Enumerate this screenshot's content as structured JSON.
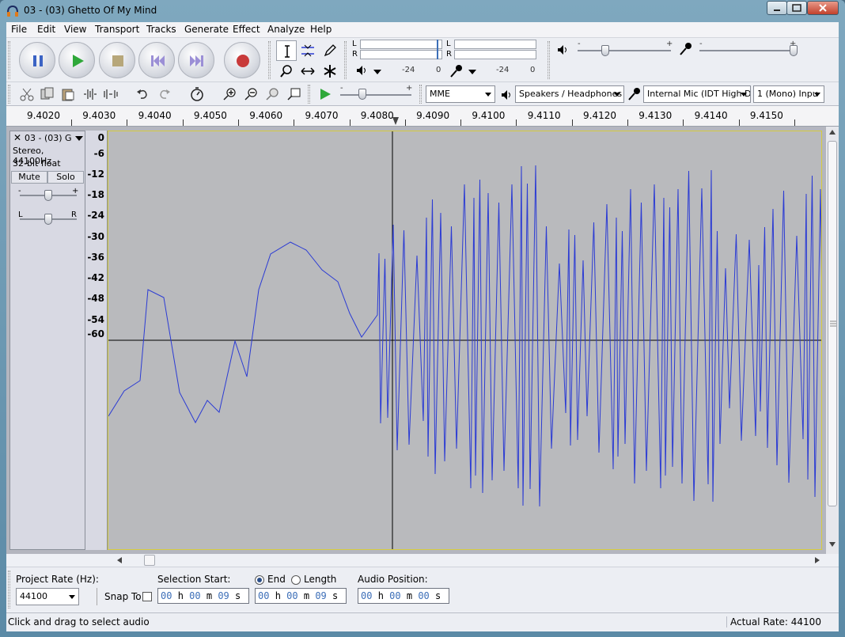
{
  "window": {
    "title": "03 - (03) Ghetto Of My Mind"
  },
  "menu": [
    "File",
    "Edit",
    "View",
    "Transport",
    "Tracks",
    "Generate",
    "Effect",
    "Analyze",
    "Help"
  ],
  "meter": {
    "play_l": "L",
    "play_r": "R",
    "rec_l": "L",
    "rec_r": "R",
    "ticks_play": [
      "-24",
      "0"
    ],
    "ticks_rec": [
      "-24",
      "0"
    ]
  },
  "device": {
    "host": "MME",
    "output": "Speakers / Headphones",
    "input": "Internal Mic (IDT High D",
    "channels": "1 (Mono) Inpu"
  },
  "ruler": {
    "ticks": [
      "9.4020",
      "9.4030",
      "9.4040",
      "9.4050",
      "9.4060",
      "9.4070",
      "9.4080",
      "9.4090",
      "9.4100",
      "9.4110",
      "9.4120",
      "9.4130",
      "9.4140",
      "9.4150"
    ]
  },
  "track": {
    "name": "03 - (03) G",
    "format": "Stereo, 44100Hz",
    "depth": "32-bit float",
    "mute": "Mute",
    "solo": "Solo",
    "gain_minus": "-",
    "gain_plus": "+",
    "pan_left": "L",
    "pan_right": "R",
    "gain_level": 0.5,
    "pan_level": 0.5
  },
  "vruler": [
    "0",
    "-6",
    "-12",
    "-18",
    "-24",
    "-30",
    "-36",
    "-42",
    "-48",
    "-54",
    "-60"
  ],
  "selection_bar": {
    "project_rate_label": "Project Rate (Hz):",
    "project_rate": "44100",
    "snap_label": "Snap To",
    "selection_start_label": "Selection Start:",
    "end_label": "End",
    "length_label": "Length",
    "audio_position_label": "Audio Position:",
    "selection_start": {
      "h": "00",
      "h_u": "h",
      "m": "00",
      "m_u": "m",
      "s": "09",
      "s_u": "s"
    },
    "selection_end": {
      "h": "00",
      "h_u": "h",
      "m": "00",
      "m_u": "m",
      "s": "09",
      "s_u": "s"
    },
    "audio_position": {
      "h": "00",
      "h_u": "h",
      "m": "00",
      "m_u": "m",
      "s": "00",
      "s_u": "s"
    }
  },
  "status": {
    "left": "Click and drag to select audio",
    "right": "Actual Rate: 44100"
  },
  "colors": {
    "waveform": "#2b3bd4",
    "track_bg": "#b9babd",
    "time_digits": "#3d6fb8"
  }
}
